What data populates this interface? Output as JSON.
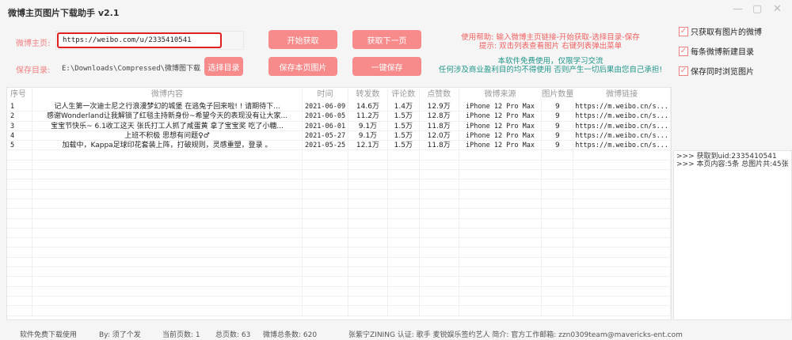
{
  "title": "微博主页图片下载助手 v2.1",
  "window": {
    "minimize": "—",
    "maximize": "▢",
    "close": "✕"
  },
  "form": {
    "home_label": "微博主页:",
    "url": "https://weibo.com/u/2335410541",
    "dir_label": "保存目录:",
    "dir": "E:\\Downloads\\Compressed\\微博图下载"
  },
  "buttons": {
    "choose_dir": "选择目录",
    "start": "开始获取",
    "next_page": "获取下一页",
    "save_page": "保存本页图片",
    "save_all": "一键保存"
  },
  "help": {
    "line1": "使用帮助:  输入微博主页链接-开始获取-选择目录-保存",
    "line2": "提示:  双击列表查看图片  右键列表弹出菜单"
  },
  "notice": {
    "line1": "本软件免费使用，仅限学习交流",
    "line2": "任何涉及商业盈利目的均不得使用 否则产生一切后果由您自己承担!"
  },
  "options": [
    {
      "label": "只获取有图片的微博",
      "checked": true
    },
    {
      "label": "每条微博新建目录",
      "checked": true
    },
    {
      "label": "保存同时浏览图片",
      "checked": true
    }
  ],
  "table": {
    "headers": [
      "序号",
      "微博内容",
      "时间",
      "转发数",
      "评论数",
      "点赞数",
      "微博来源",
      "图片数量",
      "微博链接"
    ],
    "rows": [
      [
        "1",
        "记人生第一次迪士尼之行浪漫梦幻的城堡 在逃兔子回来啦! ! 请期待下...",
        "2021-06-09",
        "14.6万",
        "1.4万",
        "12.9万",
        "iPhone 12 Pro Max",
        "9",
        "https://m.weibo.cn/s..."
      ],
      [
        "2",
        "感谢Wonderland让我解锁了红毯主持新身份~希望今天的表现没有让大家...",
        "2021-06-05",
        "11.2万",
        "1.5万",
        "12.8万",
        "iPhone 12 Pro Max",
        "9",
        "https://m.weibo.cn/s..."
      ],
      [
        "3",
        "宝宝节快乐~ 6.1收工这天 张氏打工人抓了咸蛋黄 拿了宝宝奖 吃了小糖...",
        "2021-06-01",
        "9.1万",
        "1.5万",
        "11.8万",
        "iPhone 12 Pro Max",
        "9",
        "https://m.weibo.cn/s..."
      ],
      [
        "4",
        "上班不积极 思想有问题♀♂",
        "2021-05-27",
        "9.1万",
        "1.5万",
        "12.0万",
        "iPhone 12 Pro Max",
        "9",
        "https://m.weibo.cn/s..."
      ],
      [
        "5",
        "加载中，Kappa足球印花套装上阵，打破规则，灵感重塑，登录 。",
        "2021-05-25",
        "12.1万",
        "1.5万",
        "11.8万",
        "iPhone 12 Pro Max",
        "9",
        "https://m.weibo.cn/s..."
      ]
    ]
  },
  "log": [
    ">>> 获取到uid:2335410541",
    ">>> 本页内容:5条 总图片共:45张"
  ],
  "status": {
    "free": "软件免费下载使用",
    "by": "By: 须了个发",
    "current_page": "当前页数: 1",
    "total_pages": "总页数: 63",
    "total_posts": "微博总条数: 620",
    "user": "张紫宁ZINING  认证: 歌手 麦锐娱乐签约艺人  简介: 官方工作邮箱: zzn0309team@mavericks-ent.com"
  }
}
